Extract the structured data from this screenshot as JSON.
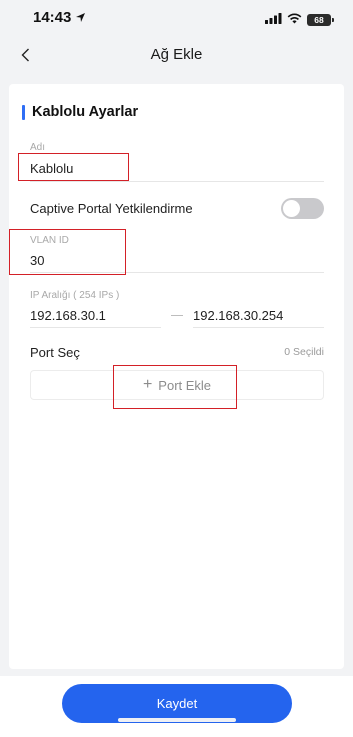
{
  "status_bar": {
    "time": "14:43",
    "battery": "68"
  },
  "header": {
    "title": "Ağ Ekle"
  },
  "section": {
    "title": "Kablolu Ayarlar"
  },
  "name_field": {
    "label": "Adı",
    "value": "Kablolu"
  },
  "captive_portal": {
    "label": "Captive Portal Yetkilendirme",
    "enabled": false
  },
  "vlan_field": {
    "label": "VLAN ID",
    "value": "30"
  },
  "ip_range": {
    "label": "IP Aralığı ( 254  IPs )",
    "start": "192.168.30.1",
    "end": "192.168.30.254"
  },
  "port_select": {
    "label": "Port Seç",
    "count": "0 Seçildi",
    "add_label": "Port Ekle"
  },
  "footer": {
    "save_label": "Kaydet"
  },
  "colors": {
    "accent": "#2464ee",
    "highlight_box": "#d32027",
    "toggle_off": "#c9c9cc"
  }
}
